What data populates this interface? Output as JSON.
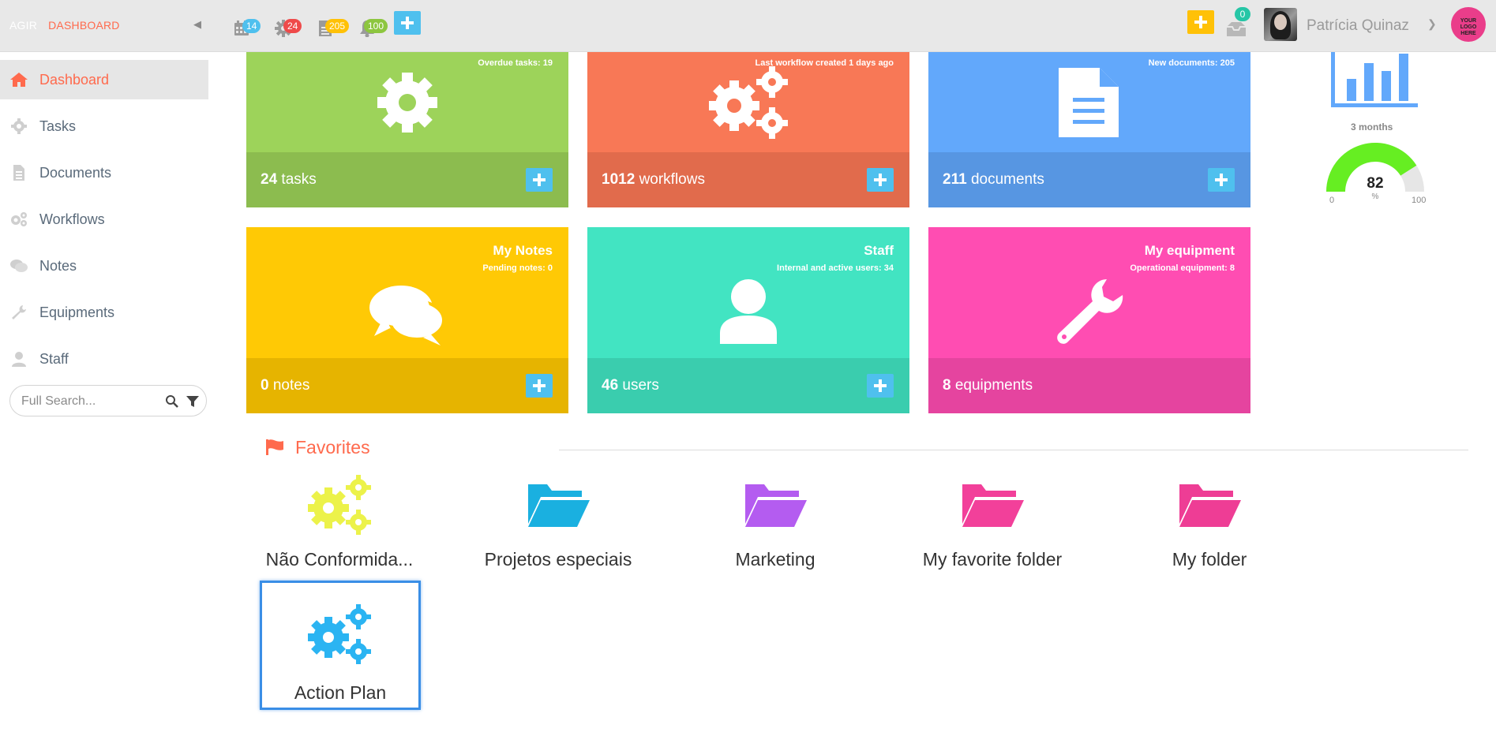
{
  "topbar": {
    "brand_agir": "AGIR",
    "brand_dashboard": "DASHBOARD",
    "badges": {
      "calendar": "14",
      "settings": "24",
      "documents": "205",
      "notifications": "100",
      "inbox": "0"
    },
    "user_name": "Patrícia Quinaz",
    "logo_text": "YOUR LOGO HERE",
    "colors": {
      "bar": "#e8e8e8",
      "accent": "#ff6a4d",
      "add_button": "#4fc0ee",
      "add_yellow": "#ffc107"
    }
  },
  "sidebar": {
    "items": [
      {
        "label": "Dashboard",
        "icon": "home-icon",
        "active": true
      },
      {
        "label": "Tasks",
        "icon": "gear-icon"
      },
      {
        "label": "Documents",
        "icon": "document-icon"
      },
      {
        "label": "Workflows",
        "icon": "gears-icon"
      },
      {
        "label": "Notes",
        "icon": "chat-icon"
      },
      {
        "label": "Equipments",
        "icon": "wrench-icon"
      },
      {
        "label": "Staff",
        "icon": "user-icon"
      }
    ],
    "search": {
      "placeholder": "Full Search..."
    }
  },
  "cards": {
    "tasks": {
      "subtitle": "Overdue tasks: 19",
      "count": "24",
      "unit": "tasks",
      "color": "#9dd35a",
      "footer_color": "#8cbc4f"
    },
    "workflows": {
      "subtitle": "Last workflow created 1 days ago",
      "count": "1012",
      "unit": "workflows",
      "color": "#f87856",
      "footer_color": "#e16b4c"
    },
    "documents": {
      "subtitle": "New documents: 205",
      "count": "211",
      "unit": "documents",
      "color": "#62a8fb",
      "footer_color": "#5796e2"
    },
    "notes": {
      "title": "My Notes",
      "subtitle": "Pending notes: 0",
      "count": "0",
      "unit": "notes",
      "color": "#ffc905",
      "footer_color": "#e6b400"
    },
    "staff": {
      "title": "Staff",
      "subtitle": "Internal and active users: 34",
      "count": "46",
      "unit": "users",
      "color": "#42e4c2",
      "footer_color": "#3acdae"
    },
    "equipment": {
      "title": "My equipment",
      "subtitle": "Operational equipment: 8",
      "count": "8",
      "unit": "equipments",
      "color": "#ff4db2",
      "footer_color": "#e5449f"
    }
  },
  "widget": {
    "period_label": "3 months",
    "gauge": {
      "value": "82",
      "unit": "%",
      "min": "0",
      "max": "100",
      "fraction": 0.82,
      "fill_color": "#66ee22",
      "track_color": "#e6e6e6"
    }
  },
  "favorites": {
    "title": "Favorites",
    "items": [
      {
        "label": "Não Conformida...",
        "icon": "gears-icon",
        "color": "#ecf24a"
      },
      {
        "label": "Projetos especiais",
        "icon": "folder-open-icon",
        "color": "#1ab0e0"
      },
      {
        "label": "Marketing",
        "icon": "folder-open-icon",
        "color": "#b45cf0"
      },
      {
        "label": "My favorite folder",
        "icon": "folder-open-icon",
        "color": "#f2409a"
      },
      {
        "label": "My folder",
        "icon": "folder-open-icon",
        "color": "#ee3d95"
      },
      {
        "label": "Action Plan",
        "icon": "gears-icon",
        "color": "#2bb4f2",
        "selected": true
      }
    ]
  }
}
